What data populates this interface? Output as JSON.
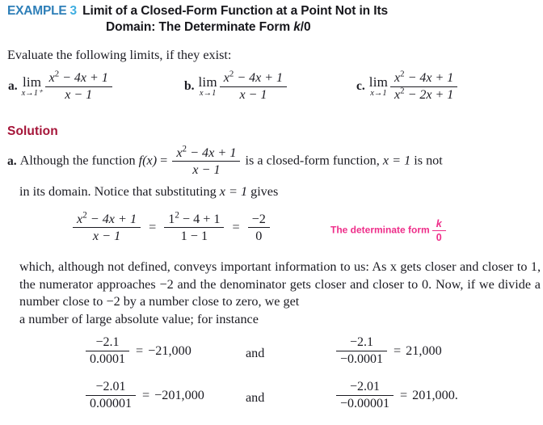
{
  "header": {
    "example_label": "EXAMPLE",
    "example_number": "3",
    "title_line1": "Limit of a Closed-Form Function at a Point Not in Its",
    "title_line2_pre": "Domain: The Determinate Form ",
    "title_line2_k": "k",
    "title_line2_post": "/0",
    "label_color": "#2E7FB8",
    "number_color": "#3FAEE0"
  },
  "intro": {
    "evaluate_text": "Evaluate the following limits, if they exist:"
  },
  "limits": [
    {
      "letter": "a.",
      "operator": "lim",
      "subscript": "x→1⁺",
      "numerator_pre": "x",
      "numerator_exp": "2",
      "numerator_post": " − 4x + 1",
      "denominator": "x − 1",
      "denominator_exp": ""
    },
    {
      "letter": "b.",
      "operator": "lim",
      "subscript": "x→1",
      "numerator_pre": "x",
      "numerator_exp": "2",
      "numerator_post": " − 4x + 1",
      "denominator": "x − 1",
      "denominator_exp": ""
    },
    {
      "letter": "c.",
      "operator": "lim",
      "subscript": "x→1",
      "numerator_pre": "x",
      "numerator_exp": "2",
      "numerator_post": " − 4x + 1",
      "denominator_pre": "x",
      "denominator_exp": "2",
      "denominator_post": " − 2x + 1"
    }
  ],
  "solution": {
    "heading": "Solution",
    "heading_color": "#A51438",
    "part_letter": "a.",
    "line1_pre": "Although the function ",
    "line1_fx": "f(x)",
    "line1_eq": " = ",
    "frac_num_pre": "x",
    "frac_num_exp": "2",
    "frac_num_post": " − 4x + 1",
    "frac_den": "x − 1",
    "line1_post": " is a closed-form function, ",
    "line1_xeq1": "x = 1",
    "line1_tail": " is not",
    "line2_pre": "in its domain. Notice that substituting ",
    "line2_xeq1": "x = 1",
    "line2_post": " gives"
  },
  "display_equation": {
    "f1_num_pre": "x",
    "f1_num_exp": "2",
    "f1_num_post": " − 4x + 1",
    "f1_den": "x − 1",
    "eq1": "=",
    "f2_num_pre": "1",
    "f2_num_exp": "2",
    "f2_num_post": " − 4 + 1",
    "f2_den": "1 − 1",
    "eq2": "=",
    "f3_num": "−2",
    "f3_den": "0",
    "note_text": "The determinate form",
    "note_num": "k",
    "note_den": "0",
    "note_color": "#EE2D89"
  },
  "paragraph": {
    "text": "which, although not defined, conveys important information to us: As x gets closer and closer to 1, the numerator approaches −2 and the denominator gets closer and closer to 0. Now, if we divide a number close to −2 by a number close to zero, we get",
    "last_line": "a number of large absolute value; for instance"
  },
  "bottom_equations": [
    {
      "left_num": "−2.1",
      "left_den": "0.0001",
      "left_eq": "=",
      "left_value": "−21,000",
      "conjunction": "and",
      "right_num": "−2.1",
      "right_den": "−0.0001",
      "right_eq": "=",
      "right_value": "21,000"
    },
    {
      "left_num": "−2.01",
      "left_den": "0.00001",
      "left_eq": "=",
      "left_value": "−201,000",
      "conjunction": "and",
      "right_num": "−2.01",
      "right_den": "−0.00001",
      "right_eq": "=",
      "right_value": "201,000."
    }
  ]
}
